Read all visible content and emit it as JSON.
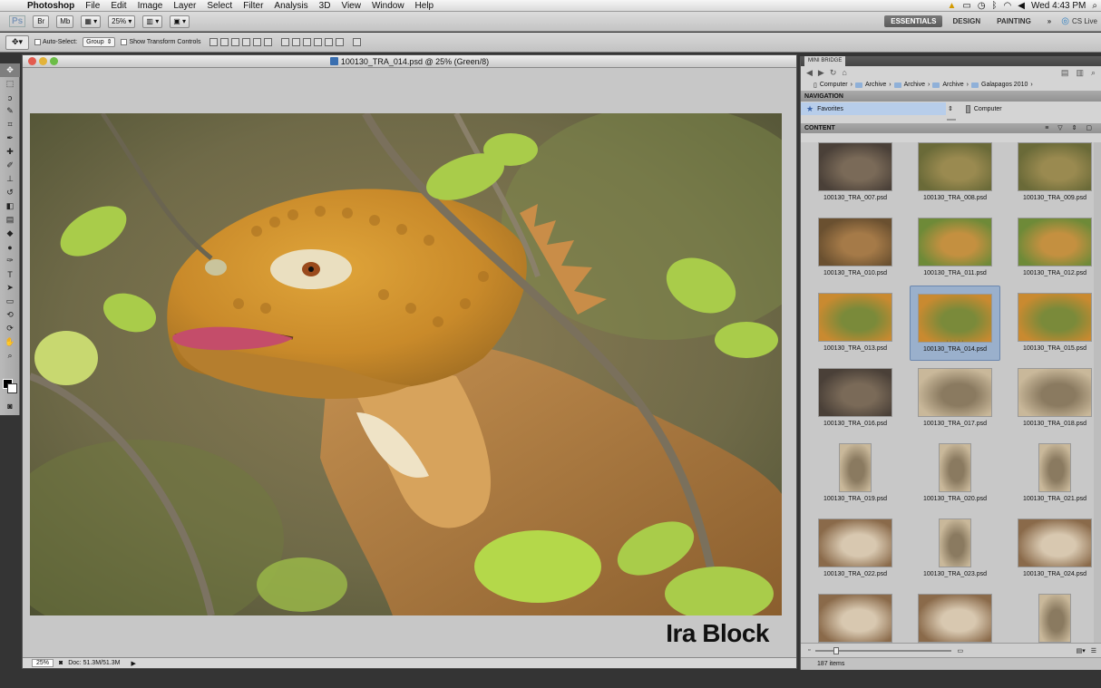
{
  "menubar": {
    "items": [
      "Photoshop",
      "File",
      "Edit",
      "Image",
      "Layer",
      "Select",
      "Filter",
      "Analysis",
      "3D",
      "View",
      "Window",
      "Help"
    ],
    "clock": "Wed 4:43 PM"
  },
  "appbar": {
    "zoom": "25%",
    "workspaces": [
      "ESSENTIALS",
      "DESIGN",
      "PAINTING"
    ],
    "more": "»",
    "cslive": "CS Live"
  },
  "options": {
    "auto_select_label": "Auto-Select:",
    "auto_select_value": "Group",
    "show_transform_label": "Show Transform Controls"
  },
  "document": {
    "title": "100130_TRA_014.psd @ 25% (Green/8)",
    "credit": "Ira Block",
    "zoom": "25%",
    "doc_size": "Doc: 51.3M/51.3M"
  },
  "panel": {
    "tab": "MINI BRIDGE",
    "breadcrumbs": [
      "Computer",
      "Archive",
      "Archive",
      "Archive",
      "Galapagos 2010"
    ],
    "navigation_header": "NAVIGATION",
    "favorites": "Favorites",
    "computer": "Computer",
    "content_header": "CONTENT",
    "item_count": "187 items",
    "thumbnails": [
      {
        "name": "100130_TRA_007.psd",
        "kind": "land",
        "tone": "dark"
      },
      {
        "name": "100130_TRA_008.psd",
        "kind": "land",
        "tone": "olive"
      },
      {
        "name": "100130_TRA_009.psd",
        "kind": "land",
        "tone": "olive"
      },
      {
        "name": "100130_TRA_010.psd",
        "kind": "land",
        "tone": "brown"
      },
      {
        "name": "100130_TRA_011.psd",
        "kind": "land",
        "tone": "green"
      },
      {
        "name": "100130_TRA_012.psd",
        "kind": "land",
        "tone": "green"
      },
      {
        "name": "100130_TRA_013.psd",
        "kind": "land",
        "tone": "orange"
      },
      {
        "name": "100130_TRA_014.psd",
        "kind": "land",
        "tone": "orange",
        "selected": true
      },
      {
        "name": "100130_TRA_015.psd",
        "kind": "land",
        "tone": "orange"
      },
      {
        "name": "100130_TRA_016.psd",
        "kind": "land",
        "tone": "dark"
      },
      {
        "name": "100130_TRA_017.psd",
        "kind": "land",
        "tone": "sand"
      },
      {
        "name": "100130_TRA_018.psd",
        "kind": "land",
        "tone": "sand"
      },
      {
        "name": "100130_TRA_019.psd",
        "kind": "portrait",
        "tone": "sand"
      },
      {
        "name": "100130_TRA_020.psd",
        "kind": "portrait",
        "tone": "sand"
      },
      {
        "name": "100130_TRA_021.psd",
        "kind": "portrait",
        "tone": "sand"
      },
      {
        "name": "100130_TRA_022.psd",
        "kind": "land",
        "tone": "bird"
      },
      {
        "name": "100130_TRA_023.psd",
        "kind": "portrait",
        "tone": "sand"
      },
      {
        "name": "100130_TRA_024.psd",
        "kind": "land",
        "tone": "bird"
      },
      {
        "name": "",
        "kind": "land",
        "tone": "bird"
      },
      {
        "name": "",
        "kind": "land",
        "tone": "bird"
      },
      {
        "name": "",
        "kind": "portrait",
        "tone": "sand"
      }
    ]
  },
  "colors": {
    "selection": "#9ab0cc",
    "favorites": "#b7cdea",
    "active_workspace": "#5f5f5f"
  }
}
